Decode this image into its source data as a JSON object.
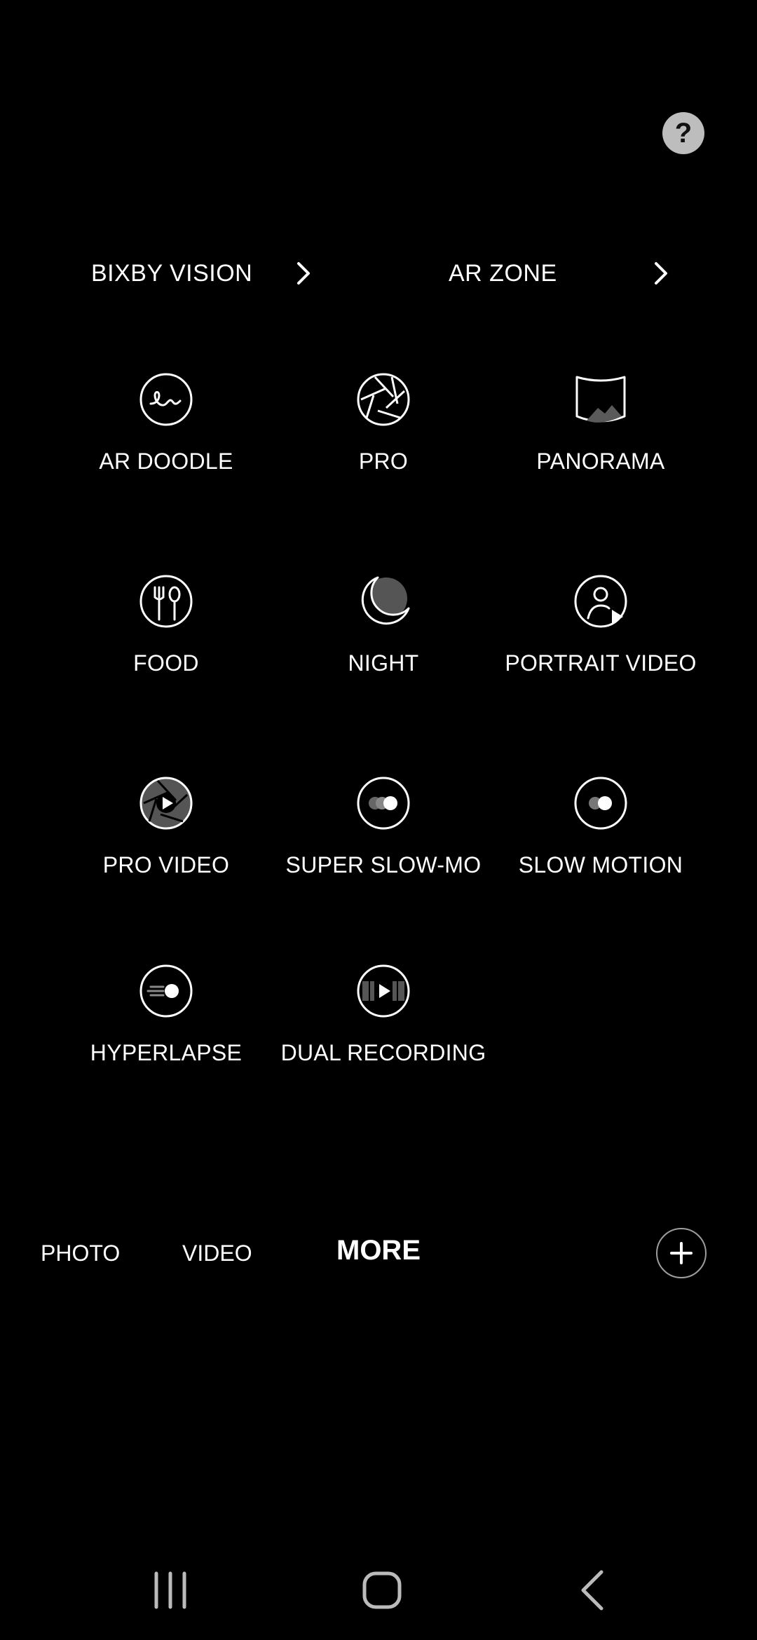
{
  "help": {
    "label": "?"
  },
  "links": [
    {
      "label": "BIXBY VISION"
    },
    {
      "label": "AR ZONE"
    }
  ],
  "modes": [
    {
      "label": "AR DOODLE",
      "icon": "ar-doodle-icon"
    },
    {
      "label": "PRO",
      "icon": "aperture-icon"
    },
    {
      "label": "PANORAMA",
      "icon": "panorama-icon"
    },
    {
      "label": "FOOD",
      "icon": "food-icon"
    },
    {
      "label": "NIGHT",
      "icon": "moon-icon"
    },
    {
      "label": "PORTRAIT VIDEO",
      "icon": "portrait-video-icon"
    },
    {
      "label": "PRO VIDEO",
      "icon": "pro-video-icon"
    },
    {
      "label": "SUPER SLOW-MO",
      "icon": "super-slow-mo-icon"
    },
    {
      "label": "SLOW MOTION",
      "icon": "slow-motion-icon"
    },
    {
      "label": "HYPERLAPSE",
      "icon": "hyperlapse-icon"
    },
    {
      "label": "DUAL RECORDING",
      "icon": "dual-recording-icon"
    }
  ],
  "tabs": [
    {
      "label": "PHOTO",
      "active": false
    },
    {
      "label": "VIDEO",
      "active": false
    },
    {
      "label": "MORE",
      "active": true
    }
  ],
  "colors": {
    "background": "#000000",
    "text": "#ffffff",
    "help_bg": "#bdbdbd"
  }
}
